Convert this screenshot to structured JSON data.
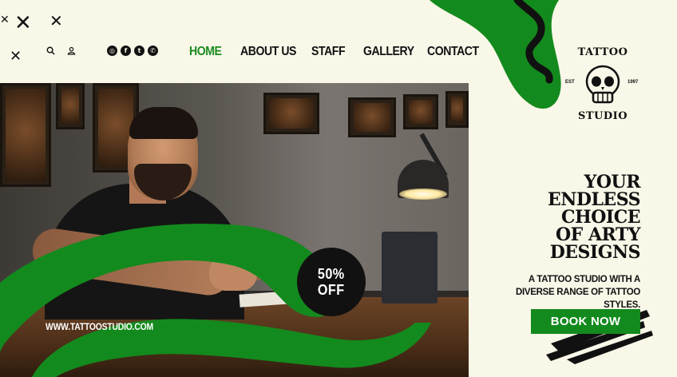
{
  "nav": {
    "items": [
      {
        "label": "HOME",
        "active": true
      },
      {
        "label": "ABOUT US",
        "active": false
      },
      {
        "label": "STAFF",
        "active": false
      },
      {
        "label": "GALLERY",
        "active": false
      },
      {
        "label": "CONTACT",
        "active": false
      }
    ]
  },
  "header": {
    "utility_icons": [
      "search-icon",
      "user-icon"
    ],
    "social_icons": [
      "instagram-icon",
      "facebook-icon",
      "twitter-icon",
      "whatsapp-icon"
    ]
  },
  "logo": {
    "top_text": "TATTOO",
    "bottom_text": "STUDIO",
    "est_label": "EST",
    "year": "1997"
  },
  "hero": {
    "badge_line1": "50%",
    "badge_line2": "OFF",
    "website": "WWW.TATTOOSTUDIO.COM"
  },
  "headline": {
    "lines": [
      "YOUR",
      "ENDLESS",
      "CHOICE",
      "OF ARTY",
      "DESIGNS"
    ]
  },
  "subtitle": {
    "line1": "A TATTOO STUDIO WITH A",
    "line2": "DIVERSE RANGE OF TATTOO STYLES."
  },
  "cta": {
    "label": "BOOK NOW"
  },
  "colors": {
    "background": "#f8f7e8",
    "accent_green": "#138a1d",
    "nav_active": "#1a8a1f",
    "text": "#111111"
  }
}
